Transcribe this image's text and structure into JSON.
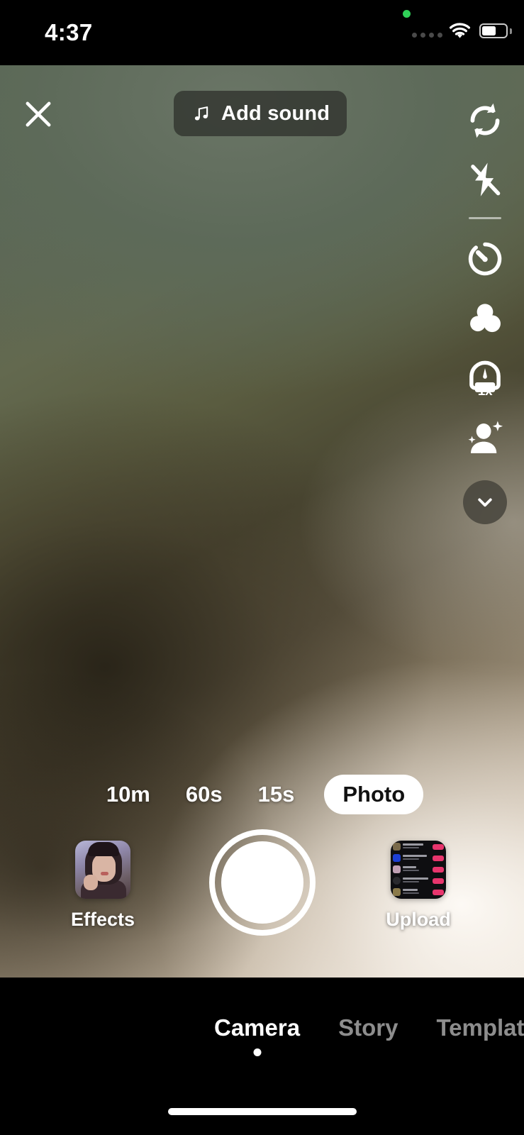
{
  "status_bar": {
    "time": "4:37",
    "recording_dot": "green-recording-indicator",
    "cellular_icon": "signal-dots-icon",
    "wifi_icon": "wifi-icon",
    "battery_icon": "battery-icon",
    "battery_level": "58"
  },
  "top_bar": {
    "close_icon": "close-icon",
    "add_sound_label": "Add sound",
    "music_icon": "music-note-icon"
  },
  "sidebar": {
    "items": [
      {
        "name": "flip-camera",
        "icon": "flip-camera-icon",
        "label": ""
      },
      {
        "name": "flash",
        "icon": "flash-off-icon",
        "label": ""
      },
      {
        "name": "timer",
        "icon": "timer-icon",
        "label": ""
      },
      {
        "name": "filters",
        "icon": "filters-icon",
        "label": ""
      },
      {
        "name": "zoom",
        "icon": "speed-gauge-icon",
        "label": "1x"
      },
      {
        "name": "enhance",
        "icon": "beautify-person-sparkle-icon",
        "label": ""
      },
      {
        "name": "expand",
        "icon": "chevron-down-icon",
        "label": ""
      }
    ],
    "zoom_value": "1x"
  },
  "modes": [
    {
      "label": "10m",
      "active": false
    },
    {
      "label": "60s",
      "active": false
    },
    {
      "label": "15s",
      "active": false
    },
    {
      "label": "Photo",
      "active": true
    }
  ],
  "capture": {
    "shutter_name": "shutter-button",
    "effects_label": "Effects",
    "effects_icon": "effects-thumbnail",
    "upload_label": "Upload",
    "upload_icon": "upload-thumbnail"
  },
  "bottom_tabs": [
    {
      "label": "Camera",
      "active": true
    },
    {
      "label": "Story",
      "active": false
    },
    {
      "label": "Template",
      "active": false
    }
  ],
  "colors": {
    "accent_white": "#ffffff",
    "inactive_tab": "#8d8d8d",
    "recording_green": "#30d158",
    "pill_bg": "#30322d",
    "upload_accent": "#e8356d"
  }
}
